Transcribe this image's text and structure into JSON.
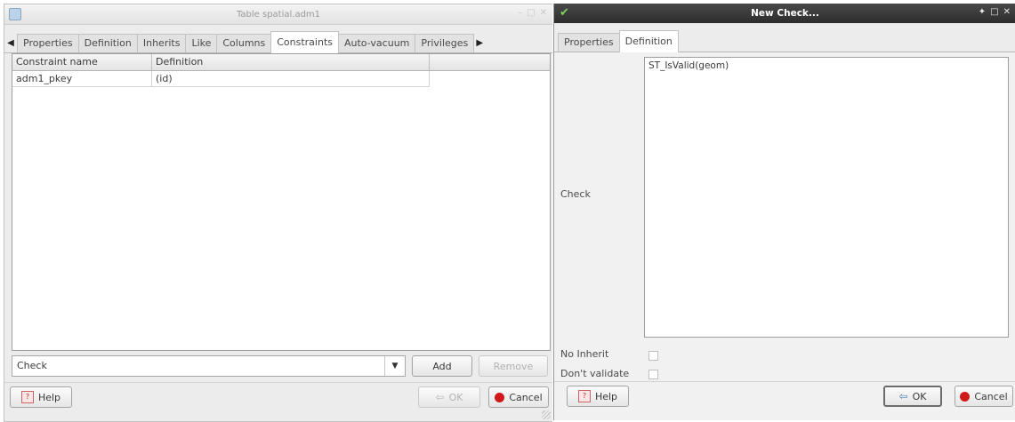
{
  "left_window": {
    "title": "Table spatial.adm1",
    "tabs": [
      "Properties",
      "Definition",
      "Inherits",
      "Like",
      "Columns",
      "Constraints",
      "Auto-vacuum",
      "Privileges"
    ],
    "active_tab": "Constraints",
    "grid": {
      "headers": [
        "Constraint name",
        "Definition"
      ],
      "rows": [
        {
          "name": "adm1_pkey",
          "definition": "(id)"
        }
      ]
    },
    "constraint_type": "Check",
    "add_label": "Add",
    "remove_label": "Remove",
    "help_label": "Help",
    "ok_label": "OK",
    "cancel_label": "Cancel"
  },
  "right_window": {
    "title": "New Check...",
    "tabs": [
      "Properties",
      "Definition"
    ],
    "active_tab": "Definition",
    "check_label": "Check",
    "check_expression": "ST_IsValid(geom)",
    "no_inherit_label": "No Inherit",
    "dont_validate_label": "Don't validate",
    "no_inherit_checked": false,
    "dont_validate_checked": false,
    "help_label": "Help",
    "ok_label": "OK",
    "cancel_label": "Cancel"
  },
  "icons": {
    "help": "help-icon",
    "ok": "ok-arrow-icon",
    "cancel": "red-dot-icon",
    "tab_left": "triangle-left-icon",
    "tab_right": "triangle-right-icon",
    "combo_arrow": "chevron-down-icon"
  },
  "colors": {
    "dialog_title_bg": "#2c2c2c",
    "cancel_icon": "#d01a1a",
    "window_bg": "#ececec"
  }
}
